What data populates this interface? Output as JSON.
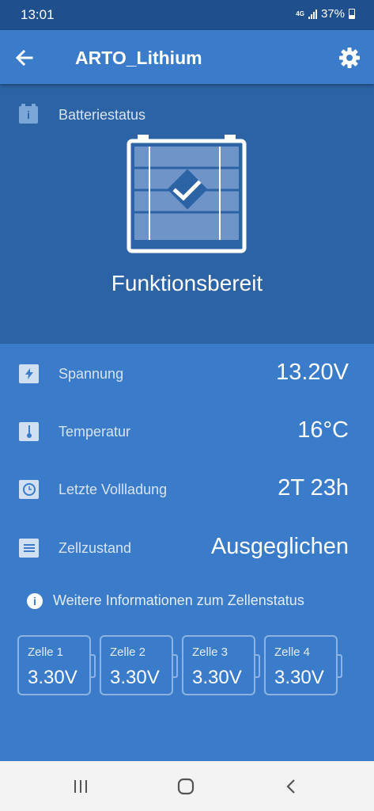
{
  "status_bar": {
    "time": "13:01",
    "network": "4G",
    "battery_percent": "37%"
  },
  "app_bar": {
    "title": "ARTO_Lithium",
    "back_icon": "arrow-left-icon",
    "settings_icon": "gear-icon"
  },
  "battery_status": {
    "section_label": "Batteriestatus",
    "state": "Funktionsbereit"
  },
  "metrics": [
    {
      "label": "Spannung",
      "value": "13.20V",
      "icon": "bolt-icon"
    },
    {
      "label": "Temperatur",
      "value": "16°C",
      "icon": "thermometer-icon"
    },
    {
      "label": "Letzte Vollladung",
      "value": "2T 23h",
      "icon": "clock-icon"
    },
    {
      "label": "Zellzustand",
      "value": "Ausgeglichen",
      "icon": "list-icon"
    }
  ],
  "more_info": {
    "label": "Weitere Informationen zum Zellenstatus"
  },
  "cells": [
    {
      "name": "Zelle 1",
      "voltage": "3.30V"
    },
    {
      "name": "Zelle 2",
      "voltage": "3.30V"
    },
    {
      "name": "Zelle 3",
      "voltage": "3.30V"
    },
    {
      "name": "Zelle 4",
      "voltage": "3.30V"
    }
  ],
  "colors": {
    "app_bar": "#3a7cc9",
    "status_panel": "#2b63a4",
    "main_panel": "#3a7cc9",
    "status_bar": "#1f4f8d"
  }
}
